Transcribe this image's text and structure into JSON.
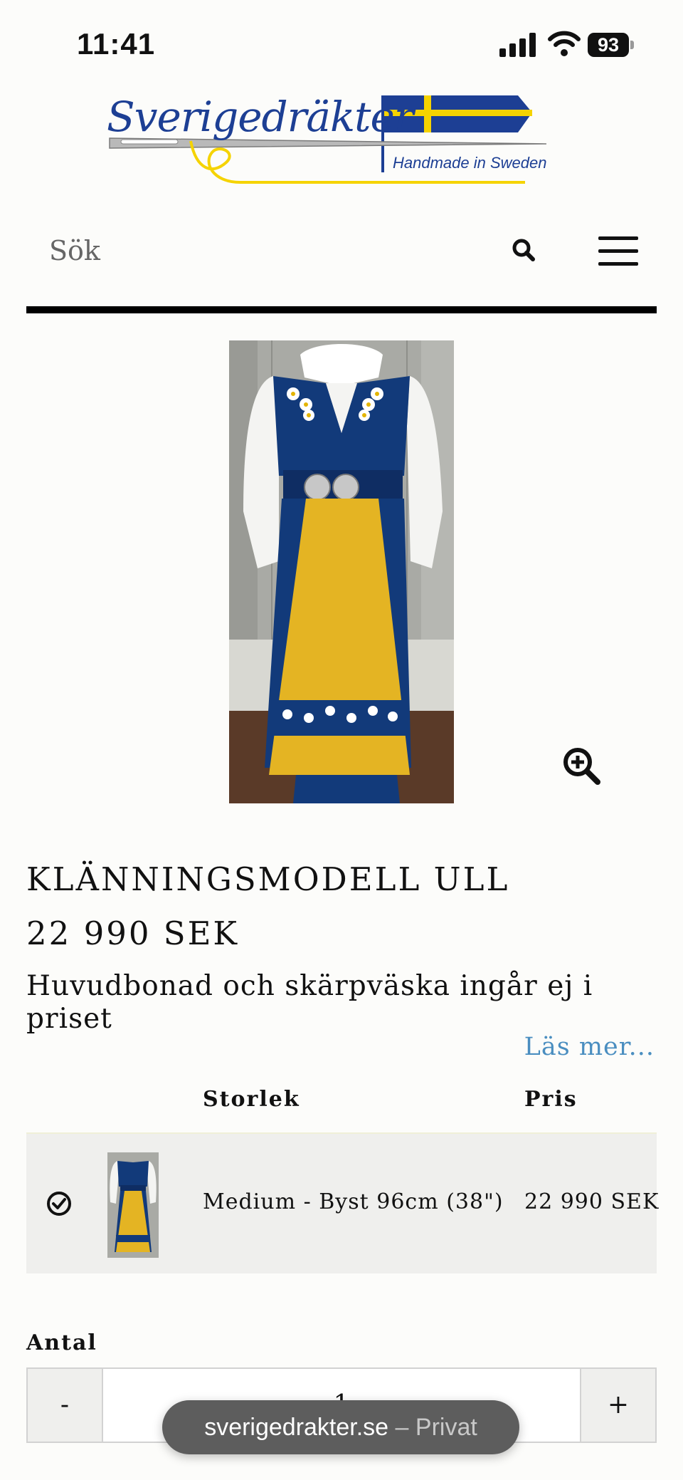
{
  "status_bar": {
    "time": "11:41",
    "battery": "93",
    "icons": [
      "signal-icon",
      "wifi-icon",
      "battery-icon"
    ]
  },
  "logo": {
    "brand": "Sverigedräkter",
    "tagline": "Handmade in Sweden",
    "colors": {
      "blue": "#1d3f94",
      "yellow": "#f5d300"
    }
  },
  "search": {
    "placeholder": "Sök",
    "icons": [
      "search-icon",
      "menu-icon"
    ]
  },
  "product": {
    "title": "KLÄNNINGSMODELL ULL",
    "price": "22 990 SEK",
    "description": "Huvudbonad och skärpväska ingår ej i priset",
    "read_more": "Läs mer...",
    "zoom_icon": "zoom-in-icon"
  },
  "variants": {
    "headers": {
      "size": "Storlek",
      "price": "Pris"
    },
    "rows": [
      {
        "size": "Medium - Byst 96cm (38\")",
        "price": "22 990 SEK",
        "selected": true
      }
    ]
  },
  "quantity": {
    "label": "Antal",
    "minus": "-",
    "value": "1",
    "plus": "+"
  },
  "browser": {
    "domain": "sverigedrakter.se",
    "mode": "– Privat"
  }
}
